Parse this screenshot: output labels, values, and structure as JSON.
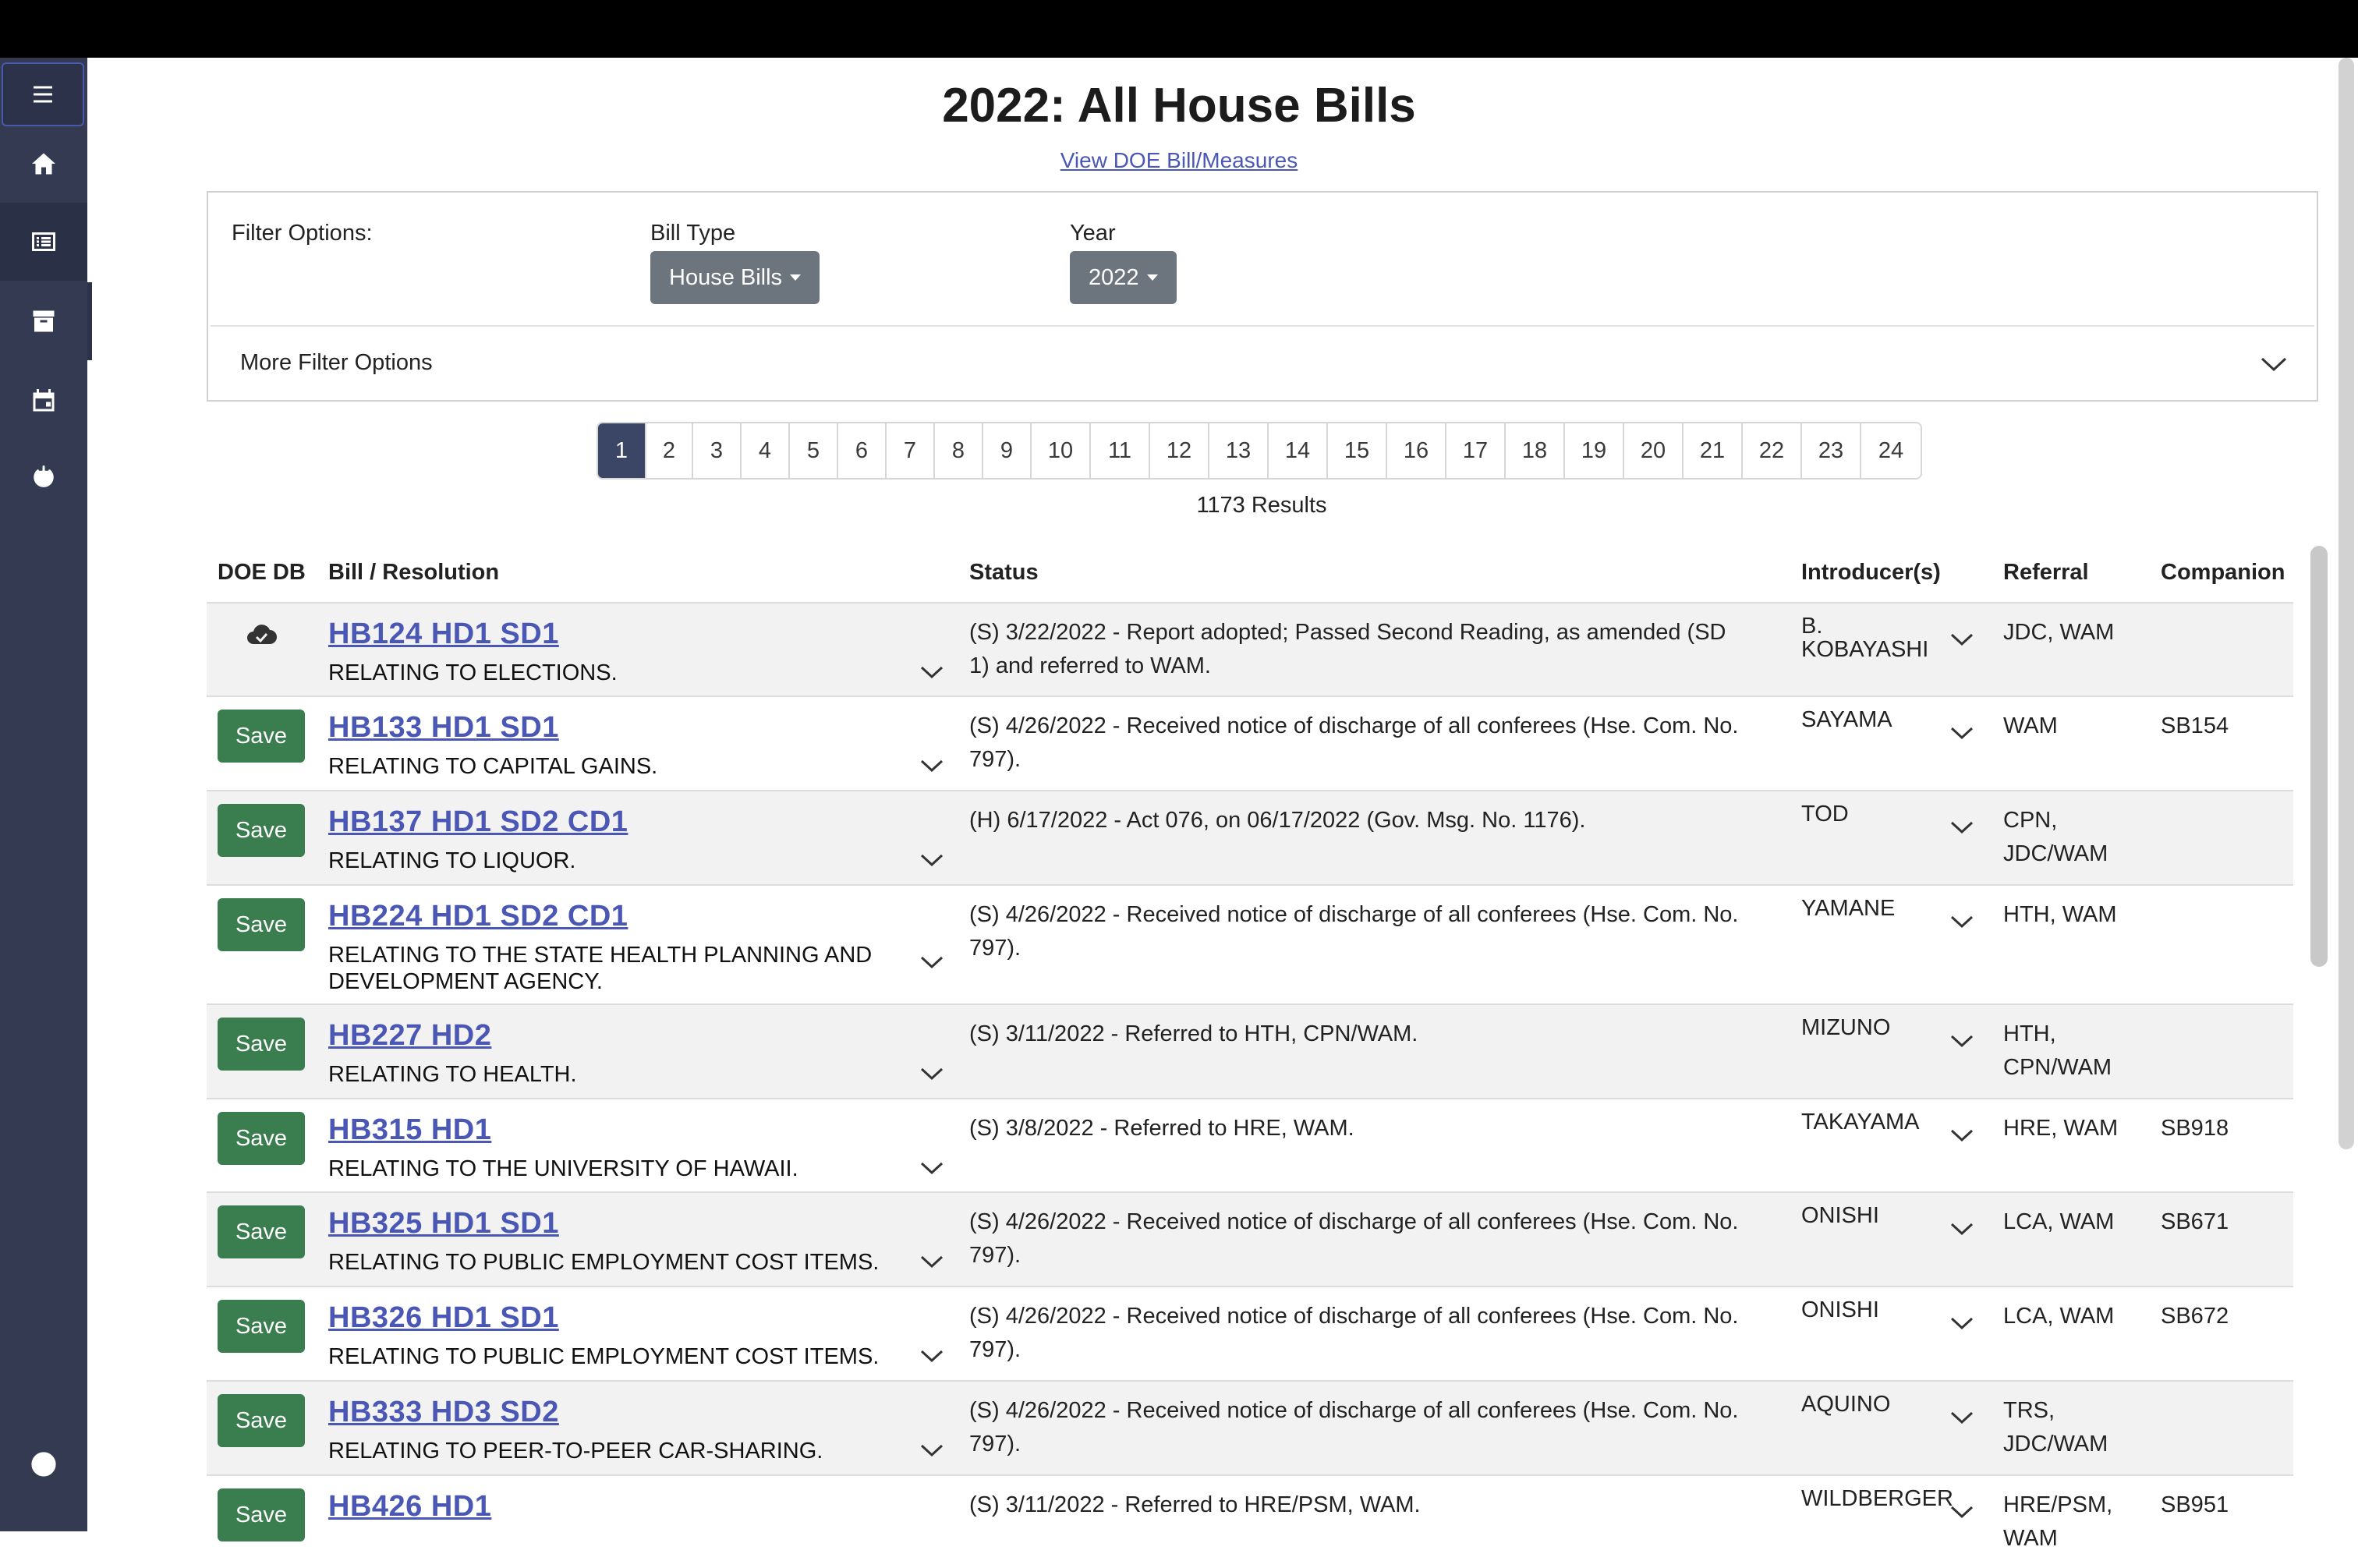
{
  "page": {
    "title": "2022: All House Bills",
    "doe_link": "View DOE Bill/Measures"
  },
  "sidebar": {
    "items": [
      {
        "icon": "menu-icon"
      },
      {
        "icon": "home-icon"
      },
      {
        "icon": "list-icon"
      },
      {
        "icon": "archive-icon"
      },
      {
        "icon": "calendar-icon"
      },
      {
        "icon": "power-icon"
      },
      {
        "icon": "help-icon"
      }
    ]
  },
  "filters": {
    "label": "Filter Options:",
    "bill_type_label": "Bill Type",
    "bill_type_value": "House Bills",
    "year_label": "Year",
    "year_value": "2022",
    "more_label": "More Filter Options"
  },
  "pagination": {
    "pages": [
      "1",
      "2",
      "3",
      "4",
      "5",
      "6",
      "7",
      "8",
      "9",
      "10",
      "11",
      "12",
      "13",
      "14",
      "15",
      "16",
      "17",
      "18",
      "19",
      "20",
      "21",
      "22",
      "23",
      "24"
    ],
    "active": "1",
    "results": "1173 Results"
  },
  "table": {
    "headers": {
      "doe_db": "DOE DB",
      "bill": "Bill / Resolution",
      "status": "Status",
      "introducers": "Introducer(s)",
      "referral": "Referral",
      "companion": "Companion"
    },
    "save_label": "Save",
    "rows": [
      {
        "bill": "HB124 HD1 SD1",
        "title": "RELATING TO ELECTIONS.",
        "status": "(S) 3/22/2022 - Report adopted; Passed Second Reading, as amended (SD 1) and referred to WAM.",
        "introducer": "B. KOBAYASHI",
        "referral": "JDC, WAM",
        "companion": "",
        "saved": true
      },
      {
        "bill": "HB133 HD1 SD1",
        "title": "RELATING TO CAPITAL GAINS.",
        "status": "(S) 4/26/2022 - Received notice of discharge of all conferees (Hse. Com. No. 797).",
        "introducer": "SAYAMA",
        "referral": "WAM",
        "companion": "SB154",
        "saved": false
      },
      {
        "bill": "HB137 HD1 SD2 CD1",
        "title": "RELATING TO LIQUOR.",
        "status": "(H) 6/17/2022 - Act 076, on 06/17/2022 (Gov. Msg. No. 1176).",
        "introducer": "TOD",
        "referral": "CPN, JDC/WAM",
        "companion": "",
        "saved": false
      },
      {
        "bill": "HB224 HD1 SD2 CD1",
        "title": "RELATING TO THE STATE HEALTH PLANNING AND DEVELOPMENT AGENCY.",
        "status": "(S) 4/26/2022 - Received notice of discharge of all conferees (Hse. Com. No. 797).",
        "introducer": "YAMANE",
        "referral": "HTH, WAM",
        "companion": "",
        "saved": false
      },
      {
        "bill": "HB227 HD2",
        "title": "RELATING TO HEALTH.",
        "status": "(S) 3/11/2022 - Referred to HTH, CPN/WAM.",
        "introducer": "MIZUNO",
        "referral": "HTH, CPN/WAM",
        "companion": "",
        "saved": false
      },
      {
        "bill": "HB315 HD1",
        "title": "RELATING TO THE UNIVERSITY OF HAWAII.",
        "status": "(S) 3/8/2022 - Referred to HRE, WAM.",
        "introducer": "TAKAYAMA",
        "referral": "HRE, WAM",
        "companion": "SB918",
        "saved": false
      },
      {
        "bill": "HB325 HD1 SD1",
        "title": "RELATING TO PUBLIC EMPLOYMENT COST ITEMS.",
        "status": "(S) 4/26/2022 - Received notice of discharge of all conferees (Hse. Com. No. 797).",
        "introducer": "ONISHI",
        "referral": "LCA, WAM",
        "companion": "SB671",
        "saved": false
      },
      {
        "bill": "HB326 HD1 SD1",
        "title": "RELATING TO PUBLIC EMPLOYMENT COST ITEMS.",
        "status": "(S) 4/26/2022 - Received notice of discharge of all conferees (Hse. Com. No. 797).",
        "introducer": "ONISHI",
        "referral": "LCA, WAM",
        "companion": "SB672",
        "saved": false
      },
      {
        "bill": "HB333 HD3 SD2",
        "title": "RELATING TO PEER-TO-PEER CAR-SHARING.",
        "status": "(S) 4/26/2022 - Received notice of discharge of all conferees (Hse. Com. No. 797).",
        "introducer": "AQUINO",
        "referral": "TRS, JDC/WAM",
        "companion": "",
        "saved": false
      },
      {
        "bill": "HB426 HD1",
        "title": "",
        "status": "(S) 3/11/2022 - Referred to HRE/PSM, WAM.",
        "introducer": "WILDBERGER",
        "referral": "HRE/PSM, WAM",
        "companion": "SB951",
        "saved": false
      }
    ]
  },
  "colors": {
    "sidebar": "#343a52",
    "link": "#4a57b5",
    "save": "#3a7d4f",
    "active_page": "#3b4565",
    "dropdown": "#6c757d"
  }
}
